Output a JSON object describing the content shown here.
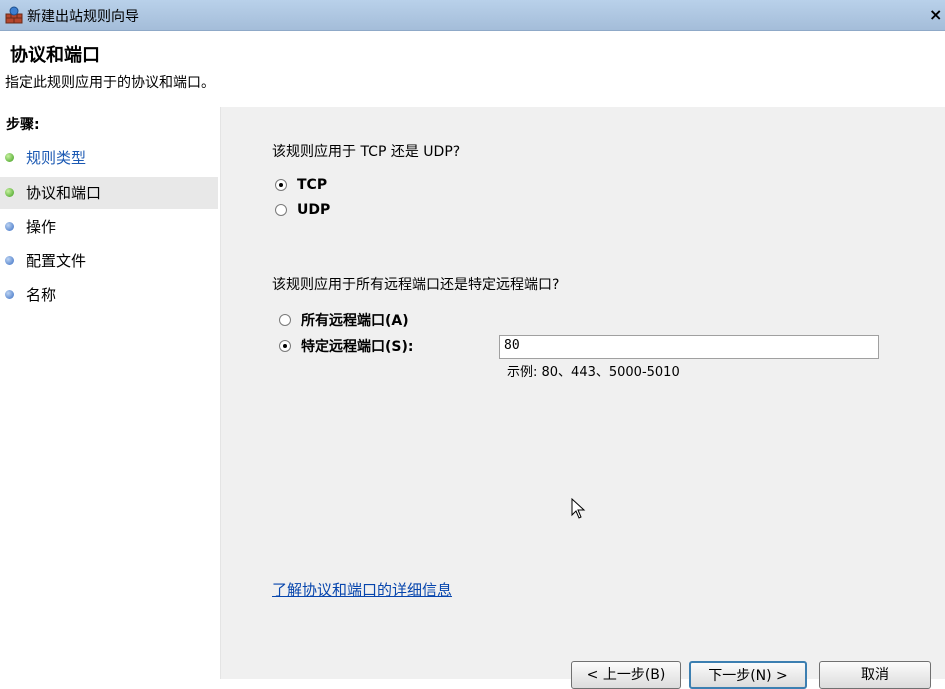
{
  "window": {
    "title": "新建出站规则向导",
    "close_label": "×"
  },
  "header": {
    "title": "协议和端口",
    "subtitle": "指定此规则应用于的协议和端口。"
  },
  "steps": {
    "label": "步骤:",
    "items": [
      {
        "label": "规则类型",
        "state": "done"
      },
      {
        "label": "协议和端口",
        "state": "current"
      },
      {
        "label": "操作",
        "state": "todo"
      },
      {
        "label": "配置文件",
        "state": "todo"
      },
      {
        "label": "名称",
        "state": "todo"
      }
    ]
  },
  "protocol": {
    "question": "该规则应用于 TCP 还是 UDP?",
    "options": [
      {
        "label": "TCP",
        "selected": true
      },
      {
        "label": "UDP",
        "selected": false
      }
    ]
  },
  "ports": {
    "question": "该规则应用于所有远程端口还是特定远程端口?",
    "options": [
      {
        "label": "所有远程端口(A)",
        "selected": false
      },
      {
        "label": "特定远程端口(S):",
        "selected": true
      }
    ],
    "value": "80",
    "example": "示例: 80、443、5000-5010"
  },
  "link": {
    "label": "了解协议和端口的详细信息"
  },
  "buttons": {
    "back": "< 上一步(B)",
    "next": "下一步(N) >",
    "cancel": "取消"
  },
  "icons": {
    "app": "firewall-wizard-icon",
    "cursor": "mouse-pointer-icon"
  }
}
